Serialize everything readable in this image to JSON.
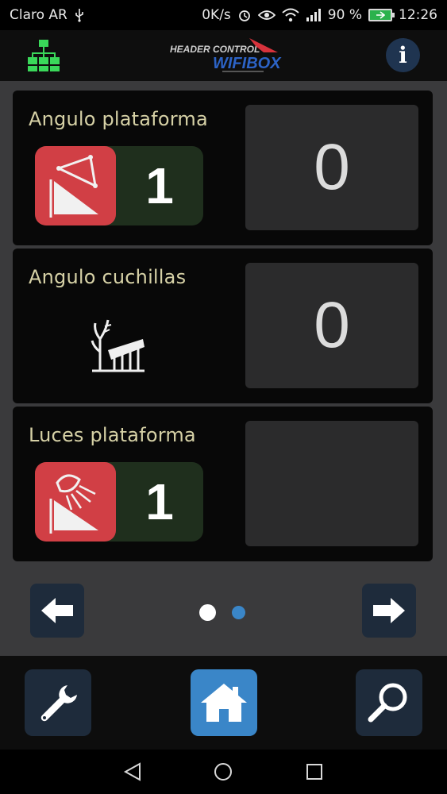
{
  "status_bar": {
    "carrier": "Claro AR",
    "net_speed": "0K/s",
    "battery_percent": "90 %",
    "time": "12:26",
    "icons": [
      "usb-icon",
      "alarm-icon",
      "eye-icon",
      "wifi-icon",
      "signal-icon",
      "battery-icon"
    ]
  },
  "header": {
    "logo_line1": "HEADER CONTROL",
    "logo_line2": "WIFIBOX",
    "info_label": "i",
    "colors": {
      "logo_red": "#d7323c",
      "logo_blue": "#2c63c6",
      "tree_green": "#3ad85a"
    }
  },
  "cards": [
    {
      "title": "Angulo plataforma",
      "value": "0",
      "toggle_value": "1",
      "icon": "platform-angle-icon"
    },
    {
      "title": "Angulo cuchillas",
      "value": "0",
      "icon": "blades-angle-icon"
    },
    {
      "title": "Luces plataforma",
      "value": "",
      "toggle_value": "1",
      "icon": "platform-light-icon"
    }
  ],
  "pager": {
    "pages": 2,
    "current": 1,
    "colors": {
      "active": "#ffffff",
      "inactive": "#3a86c8"
    }
  },
  "bottom_nav": {
    "items": [
      "wrench-icon",
      "home-icon",
      "search-icon"
    ],
    "active": "home-icon"
  },
  "accent": {
    "card_red": "#d13f45",
    "toggle_green": "#1f2f1d",
    "button_blue": "#1e2b3b"
  }
}
